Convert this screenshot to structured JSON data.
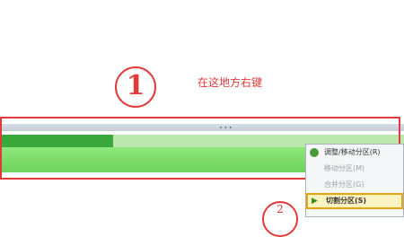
{
  "annotation": {
    "step_numeral": "1",
    "instruction": "在这地方右键",
    "next_step_numeral": "2",
    "color": "#e23a3a"
  },
  "separator": {
    "handle_glyph": "∙∙∙"
  },
  "partition": {
    "usage_fraction": 0.28,
    "used_color": "#3aa83a",
    "free_color": "#8fe07a"
  },
  "context_menu": {
    "items": [
      {
        "label": "调整/移动分区(R)",
        "icon": "resize-icon",
        "enabled": true
      },
      {
        "label": "移动分区(M)",
        "icon": "",
        "enabled": false
      },
      {
        "label": "合并分区(G)",
        "icon": "",
        "enabled": false
      },
      {
        "label": "切割分区(S)",
        "icon": "arrow-right-icon",
        "enabled": true,
        "highlighted": true
      }
    ]
  }
}
